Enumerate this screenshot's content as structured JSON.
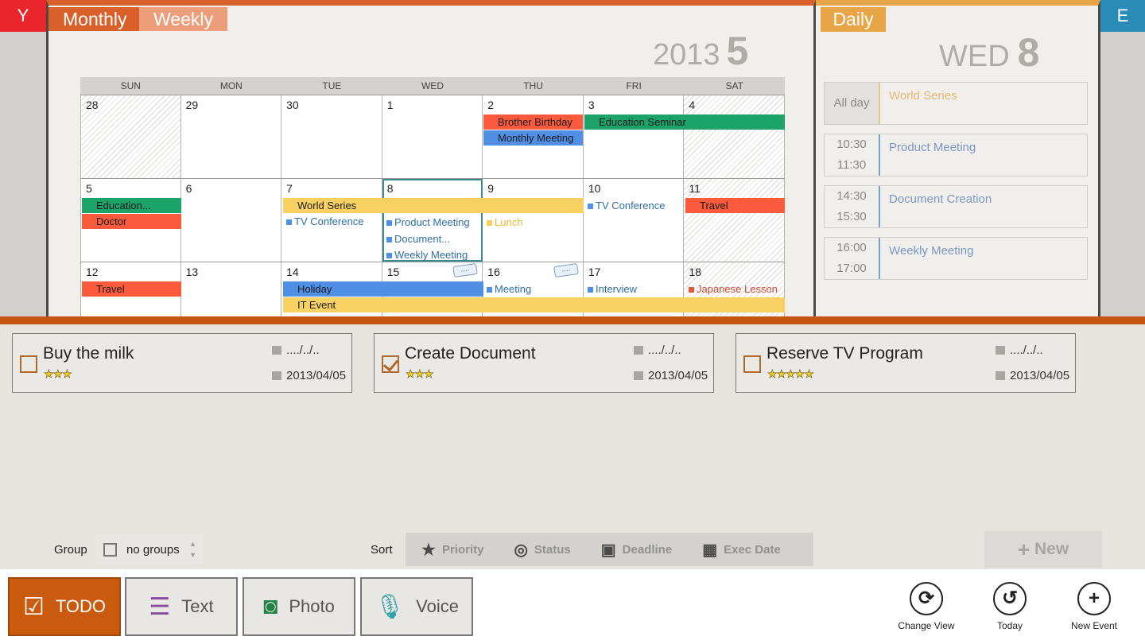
{
  "side_tabs": {
    "left": "Y",
    "right": "E"
  },
  "view_tabs": {
    "monthly": "Monthly",
    "weekly": "Weekly",
    "daily": "Daily"
  },
  "month_header": {
    "year": "2013",
    "month": "5"
  },
  "weekdays": [
    "SUN",
    "MON",
    "TUE",
    "WED",
    "THU",
    "FRI",
    "SAT"
  ],
  "weeks": [
    [
      "28",
      "29",
      "30",
      "1",
      "2",
      "3",
      "4"
    ],
    [
      "5",
      "6",
      "7",
      "8",
      "9",
      "10",
      "11"
    ],
    [
      "12",
      "13",
      "14",
      "15",
      "16",
      "17",
      "18"
    ]
  ],
  "events": {
    "brother_birthday": "Brother Birthday",
    "monthly_meeting": "Monthly Meeting",
    "education_seminar": "Education Seminar",
    "education_short": "Education...",
    "doctor": "Doctor",
    "world_series": "World Series",
    "tv_conference_tue": "TV Conference",
    "product_meeting": "Product Meeting",
    "document": "Document...",
    "weekly_meeting": "Weekly Meeting",
    "lunch": "Lunch",
    "tv_conference_fri": "TV Conference",
    "travel_sat": "Travel",
    "travel_sun": "Travel",
    "holiday": "Holiday",
    "it_event": "IT Event",
    "meeting": "Meeting",
    "interview": "Interview",
    "japanese_lesson": "Japanese Lesson",
    "memo_icon": "...."
  },
  "daily": {
    "weekday": "WED",
    "day": "8",
    "slots": [
      {
        "start": "All day",
        "end": "",
        "title": "World Series"
      },
      {
        "start": "10:30",
        "end": "11:30",
        "title": "Product Meeting"
      },
      {
        "start": "14:30",
        "end": "15:30",
        "title": "Document Creation"
      },
      {
        "start": "16:00",
        "end": "17:00",
        "title": "Weekly Meeting"
      }
    ]
  },
  "todos": [
    {
      "title": "Buy the milk",
      "checked": false,
      "stars": "★★★",
      "exec_date": "..../../..",
      "deadline": "2013/04/05"
    },
    {
      "title": "Create Document",
      "checked": true,
      "stars": "★★★",
      "exec_date": "..../../..",
      "deadline": "2013/04/05"
    },
    {
      "title": "Reserve TV Program",
      "checked": false,
      "stars": "★★★★★",
      "exec_date": "..../../..",
      "deadline": "2013/04/05"
    }
  ],
  "toolbar": {
    "group_label": "Group",
    "group_value": "no groups",
    "sort_label": "Sort",
    "sort_options": [
      "Priority",
      "Status",
      "Deadline",
      "Exec Date"
    ],
    "new_label": "New"
  },
  "modes": [
    "TODO",
    "Text",
    "Photo",
    "Voice"
  ],
  "app_bar": {
    "change_view": "Change View",
    "today": "Today",
    "new_event": "New Event"
  },
  "colors": {
    "accent_orange": "#c95a0e",
    "monthly_tab": "#d9602a",
    "daily_tab": "#e8a548",
    "event_red": "#fb5a3c",
    "event_blue": "#4f8fe6",
    "event_green": "#1ba36a",
    "event_yellow": "#f8d162"
  }
}
